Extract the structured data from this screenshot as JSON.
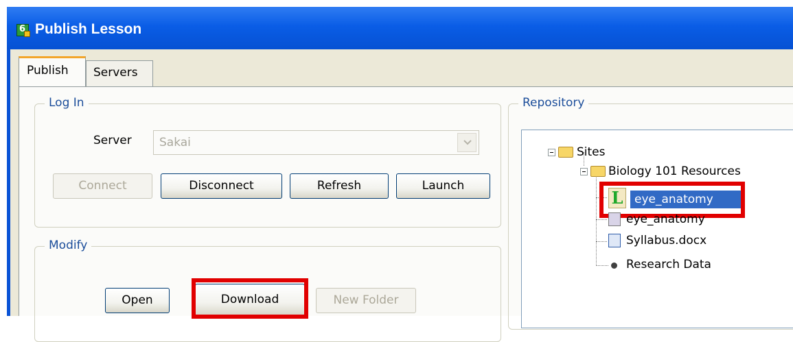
{
  "window": {
    "title": "Publish Lesson",
    "icon": "lesson-builder-app-icon"
  },
  "tabs": [
    {
      "label": "Publish",
      "selected": true
    },
    {
      "label": "Servers",
      "selected": false
    }
  ],
  "login": {
    "group_label": "Log In",
    "server_label": "Server",
    "server_value": "Sakai",
    "buttons": {
      "connect": "Connect",
      "disconnect": "Disconnect",
      "refresh": "Refresh",
      "launch": "Launch"
    }
  },
  "modify": {
    "group_label": "Modify",
    "buttons": {
      "open": "Open",
      "download": "Download",
      "new_folder": "New Folder"
    }
  },
  "repository": {
    "group_label": "Repository",
    "tree": {
      "root": "Sites",
      "folder": "Biology 101 Resources",
      "items": [
        "eye_anatomy",
        "eye_anatomy",
        "Syllabus.docx",
        "Research Data"
      ]
    }
  },
  "colors": {
    "highlight": "#e10000",
    "selection": "#316ac5",
    "title_bar": "#0a5de6"
  }
}
